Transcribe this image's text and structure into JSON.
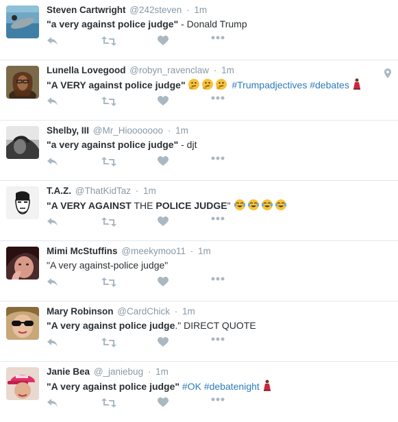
{
  "tweets": [
    {
      "fullname": "Steven Cartwright",
      "username": "@242steven",
      "time": "1m",
      "text_bold": "\"a very against police judge\"",
      "text_rest": " - Donald Trump",
      "hashtags": "",
      "avatar": "dolphin-photo"
    },
    {
      "fullname": "Lunella Lovegood",
      "username": "@robyn_ravenclaw",
      "time": "1m",
      "text_bold": "\"A VERY against police judge\"",
      "text_rest": "",
      "emoji": "thinking-face-emoji x3",
      "hashtags": "#Trumpadjectives #debates",
      "end_emoji": "dancer-emoji",
      "has_location": true,
      "avatar": "person-with-glasses"
    },
    {
      "fullname": "Shelby, III",
      "username": "@Mr_Hiooooooo",
      "time": "1m",
      "text_bold": "\"a very against police judge\"",
      "text_rest": " - djt",
      "hashtags": "",
      "avatar": "bw-portrait"
    },
    {
      "fullname": "T.A.Z.",
      "username": "@ThatKidTaz",
      "time": "1m",
      "text_bold_1": "\"A VERY AGAINST",
      "text_mid": " THE ",
      "text_bold_2": "POLICE JUDGE",
      "text_end": "\"",
      "emoji": "tears-of-joy-emoji x4",
      "avatar": "cartoon-face"
    },
    {
      "fullname": "Mimi McStuffins",
      "username": "@meekymoo11",
      "time": "1m",
      "text_plain": "\"A very against-police judge\"",
      "avatar": "selfie-photo"
    },
    {
      "fullname": "Mary Robinson",
      "username": "@CardChick",
      "time": "1m",
      "text_bold": "\"A very against police judge",
      "text_rest": ".\" DIRECT QUOTE",
      "avatar": "sunglasses-photo"
    },
    {
      "fullname": "Janie Bea",
      "username": "@_janiebug",
      "time": "1m",
      "text_bold": "\"A very against police judge\"",
      "hashtags": " #OK #debatenight",
      "end_emoji": "dancer-emoji",
      "avatar": "pink-cap-photo"
    }
  ],
  "colors": {
    "name": "#292f33",
    "meta": "#8899a6",
    "hashtag": "#2b7bb9",
    "action_icon": "#aab8c2",
    "divider": "#e1e8ed"
  }
}
